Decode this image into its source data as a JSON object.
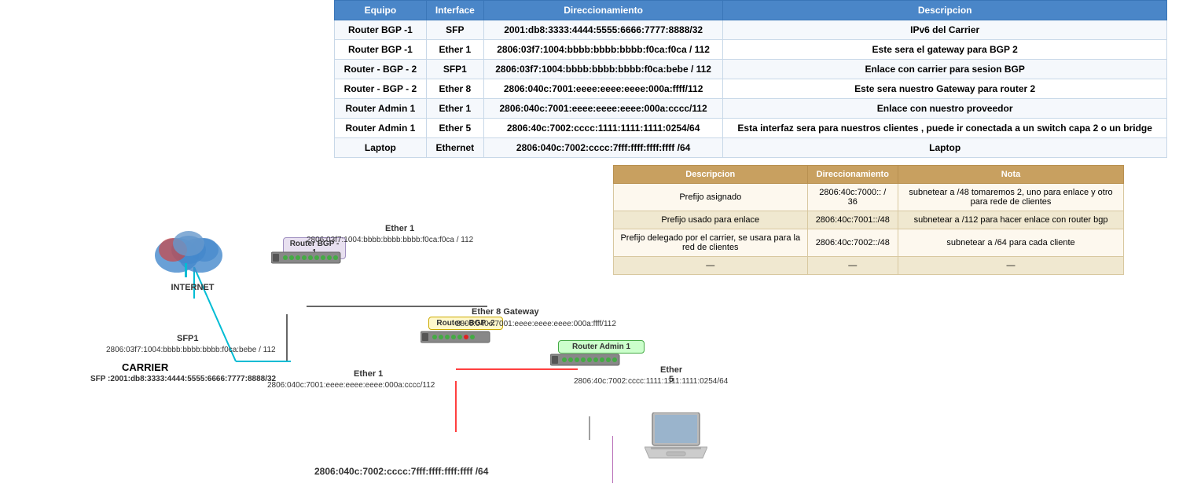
{
  "table1": {
    "headers": [
      "Equipo",
      "Interface",
      "Direccionamiento",
      "Descripcion"
    ],
    "rows": [
      [
        "Router BGP -1",
        "SFP",
        "2001:db8:3333:4444:5555:6666:7777:8888/32",
        "IPv6 del Carrier"
      ],
      [
        "Router BGP -1",
        "Ether 1",
        "2806:03f7:1004:bbbb:bbbb:bbbb:f0ca:f0ca / 112",
        "Este sera el gateway para BGP 2"
      ],
      [
        "Router - BGP - 2",
        "SFP1",
        "2806:03f7:1004:bbbb:bbbb:bbbb:f0ca:bebe / 112",
        "Enlace con carrier para sesion BGP"
      ],
      [
        "Router - BGP - 2",
        "Ether 8",
        "2806:040c:7001:eeee:eeee:eeee:000a:ffff/112",
        "Este sera nuestro Gateway para router 2"
      ],
      [
        "Router Admin 1",
        "Ether 1",
        "2806:040c:7001:eeee:eeee:eeee:000a:cccc/112",
        "Enlace con nuestro proveedor"
      ],
      [
        "Router Admin 1",
        "Ether 5",
        "2806:40c:7002:cccc:1111:1111:1111:0254/64",
        "Esta interfaz sera para nuestros clientes , puede ir conectada a un switch capa 2 o un bridge"
      ],
      [
        "Laptop",
        "Ethernet",
        "2806:040c:7002:cccc:7fff:ffff:ffff:ffff /64",
        "Laptop"
      ]
    ]
  },
  "table2": {
    "headers": [
      "Descripcion",
      "Direccionamiento",
      "Nota"
    ],
    "rows": [
      [
        "Prefijo asignado",
        "2806:40c:7000:: / 36",
        "subnetear a /48  tomaremos 2, uno para enlace y otro para rede de clientes"
      ],
      [
        "Prefijo usado para enlace",
        "2806:40c:7001::/48",
        "subnetear a /112 para hacer enlace con router bgp"
      ],
      [
        "Prefijo delegado por el carrier, se usara para la red de clientes",
        "2806:40c:7002::/48",
        "subnetear a /64 para cada cliente"
      ],
      [
        "—",
        "—",
        "—"
      ]
    ]
  },
  "diagram": {
    "internet_label": "INTERNET",
    "carrier_label": "CARRIER",
    "carrier_address": "SFP :2001:db8:3333:4444:5555:6666:7777:8888/32",
    "router_bgp1_label": "Router BGP -\n1",
    "router_bgp2_label": "Router - BGP -2",
    "router_admin1_label": "Router Admin 1",
    "ether1_label": "Ether 1",
    "ether1_addr": "2806:03f7:1004:bbbb:bbbb:bbbb:f0ca:f0ca / 112",
    "sfp1_label": "SFP1",
    "sfp1_addr": "2806:03f7:1004:bbbb:bbbb:bbbb:f0ca:bebe / 112",
    "ether8_label": "Ether 8 Gateway",
    "ether8_addr": "2806:040c:7001:eeee:eeee:eeee:000a:ffff/112",
    "ether1_admin_label": "Ether 1",
    "ether1_admin_addr": "2806:040c:7001:eeee:eeee:eeee:000a:cccc/112",
    "ether5_label": "Ether 5",
    "ether5_addr": "2806:40c:7002:cccc:1111:1111:1111:0254/64",
    "laptop_addr": "2806:040c:7002:cccc:7fff:ffff:ffff:ffff /64",
    "laptop_label": "Laptop"
  }
}
